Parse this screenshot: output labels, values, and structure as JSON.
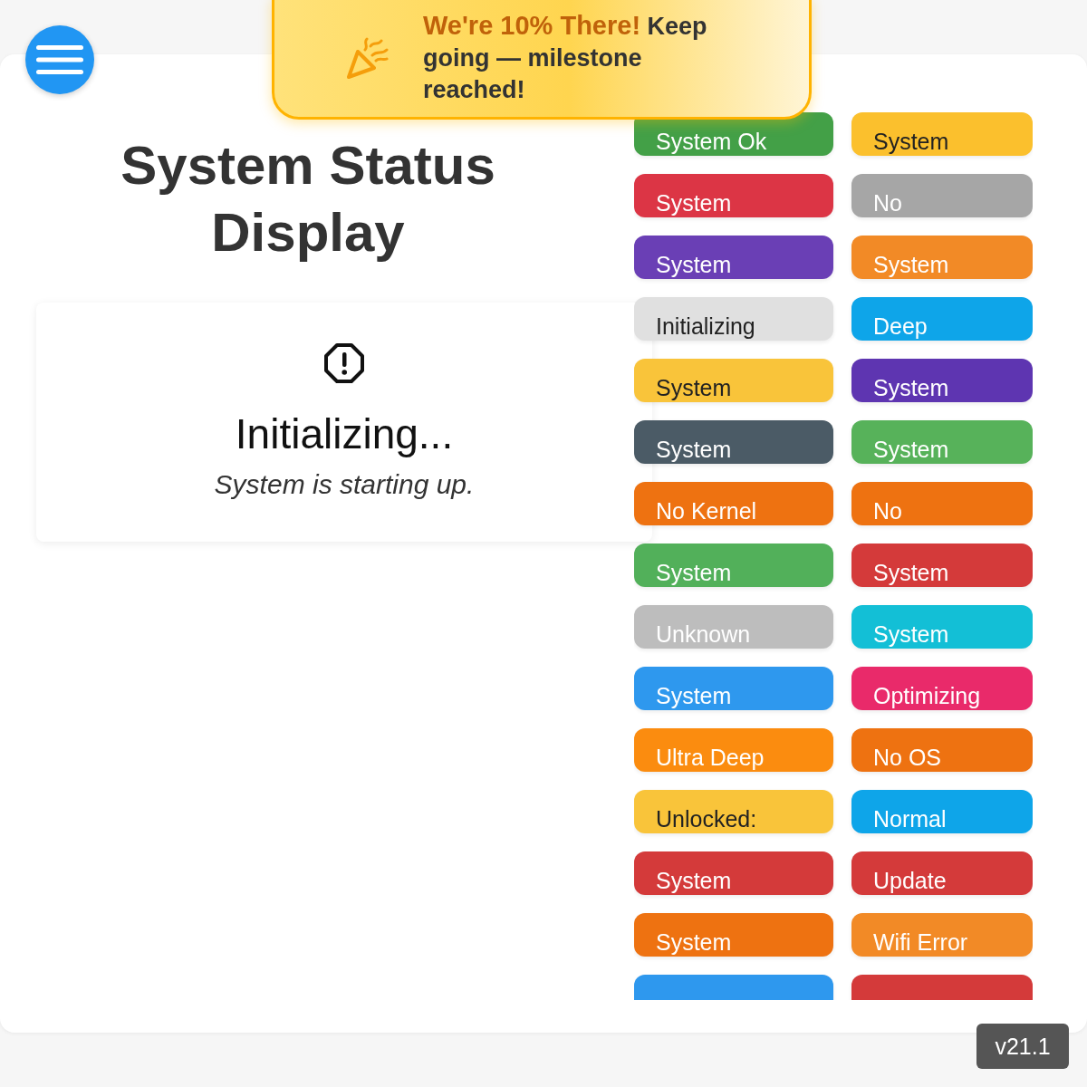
{
  "toast": {
    "headline": "We're 10% There!",
    "message": "Keep going — milestone reached!"
  },
  "title": "System Status Display",
  "status": {
    "heading": "Initializing...",
    "detail": "System is starting up."
  },
  "tiles": [
    {
      "label": "System Ok",
      "color": "#43a047",
      "kind": "dark"
    },
    {
      "label": "System",
      "color": "#fbc02d",
      "kind": "light"
    },
    {
      "label": "System",
      "color": "#dc3545",
      "kind": "dark"
    },
    {
      "label": "No",
      "color": "#a6a6a6",
      "kind": "dark"
    },
    {
      "label": "System",
      "color": "#6a3fb5",
      "kind": "dark"
    },
    {
      "label": "System",
      "color": "#f28a26",
      "kind": "dark"
    },
    {
      "label": "Initializing",
      "color": "#e0e0e0",
      "kind": "light"
    },
    {
      "label": "Deep",
      "color": "#0ea5e9",
      "kind": "dark"
    },
    {
      "label": "System",
      "color": "#f9c43a",
      "kind": "light"
    },
    {
      "label": "System",
      "color": "#5e35b1",
      "kind": "dark"
    },
    {
      "label": "System",
      "color": "#4b5b66",
      "kind": "dark"
    },
    {
      "label": "System",
      "color": "#57b25a",
      "kind": "dark"
    },
    {
      "label": "No Kernel",
      "color": "#ee7211",
      "kind": "dark"
    },
    {
      "label": "No",
      "color": "#ee7211",
      "kind": "dark"
    },
    {
      "label": "System",
      "color": "#52b05a",
      "kind": "dark"
    },
    {
      "label": "System",
      "color": "#d43a3a",
      "kind": "dark"
    },
    {
      "label": "Unknown",
      "color": "#bdbdbd",
      "kind": "dark"
    },
    {
      "label": "System",
      "color": "#13bfd6",
      "kind": "dark"
    },
    {
      "label": "System",
      "color": "#2e98ee",
      "kind": "dark"
    },
    {
      "label": "Optimizing",
      "color": "#e92a6a",
      "kind": "dark"
    },
    {
      "label": "Ultra Deep",
      "color": "#fb8c0f",
      "kind": "dark"
    },
    {
      "label": "No OS",
      "color": "#ee7211",
      "kind": "dark"
    },
    {
      "label": "Unlocked:",
      "color": "#f9c43a",
      "kind": "light"
    },
    {
      "label": "Normal",
      "color": "#0ea5e9",
      "kind": "dark"
    },
    {
      "label": "System",
      "color": "#d43a3a",
      "kind": "dark"
    },
    {
      "label": "Update",
      "color": "#d43a3a",
      "kind": "dark"
    },
    {
      "label": "System",
      "color": "#ee7211",
      "kind": "dark"
    },
    {
      "label": "Wifi Error",
      "color": "#f28a26",
      "kind": "dark"
    },
    {
      "color": "#2e98ee",
      "kind": "dark"
    },
    {
      "color": "#d43a3a",
      "kind": "dark"
    }
  ],
  "version": "v21.1"
}
